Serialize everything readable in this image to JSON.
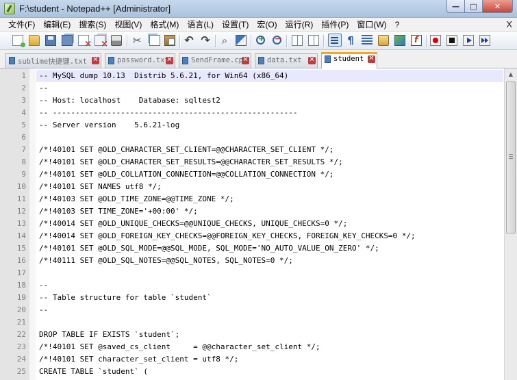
{
  "window": {
    "title": "F:\\student - Notepad++ [Administrator]",
    "min_label": "—",
    "max_label": "□",
    "close_label": "✕"
  },
  "menu": [
    "文件(F)",
    "编辑(E)",
    "搜索(S)",
    "视图(V)",
    "格式(M)",
    "语言(L)",
    "设置(T)",
    "宏(O)",
    "运行(R)",
    "插件(P)",
    "窗口(W)",
    "?"
  ],
  "menubar_close": "X",
  "tabs": [
    {
      "label": "sublime快捷键.txt",
      "active": false
    },
    {
      "label": "password.txt",
      "active": false
    },
    {
      "label": "SendFrame.cpp",
      "active": false
    },
    {
      "label": "data.txt",
      "active": false
    },
    {
      "label": "student",
      "active": true
    }
  ],
  "tab_close_glyph": "✕",
  "editor": {
    "current_line": 1,
    "lines": [
      {
        "n": "1",
        "text": "-- MySQL dump 10.13  Distrib 5.6.21, for Win64 (x86_64)"
      },
      {
        "n": "2",
        "text": "--"
      },
      {
        "n": "3",
        "text": "-- Host: localhost    Database: sqltest2"
      },
      {
        "n": "4",
        "text": "-- ------------------------------------------------------"
      },
      {
        "n": "5",
        "text": "-- Server version\t5.6.21-log"
      },
      {
        "n": "6",
        "text": ""
      },
      {
        "n": "7",
        "text": "/*!40101 SET @OLD_CHARACTER_SET_CLIENT=@@CHARACTER_SET_CLIENT */;"
      },
      {
        "n": "8",
        "text": "/*!40101 SET @OLD_CHARACTER_SET_RESULTS=@@CHARACTER_SET_RESULTS */;"
      },
      {
        "n": "9",
        "text": "/*!40101 SET @OLD_COLLATION_CONNECTION=@@COLLATION_CONNECTION */;"
      },
      {
        "n": "10",
        "text": "/*!40101 SET NAMES utf8 */;"
      },
      {
        "n": "11",
        "text": "/*!40103 SET @OLD_TIME_ZONE=@@TIME_ZONE */;"
      },
      {
        "n": "12",
        "text": "/*!40103 SET TIME_ZONE='+00:00' */;"
      },
      {
        "n": "13",
        "text": "/*!40014 SET @OLD_UNIQUE_CHECKS=@@UNIQUE_CHECKS, UNIQUE_CHECKS=0 */;"
      },
      {
        "n": "14",
        "text": "/*!40014 SET @OLD_FOREIGN_KEY_CHECKS=@@FOREIGN_KEY_CHECKS, FOREIGN_KEY_CHECKS=0 */;"
      },
      {
        "n": "15",
        "text": "/*!40101 SET @OLD_SQL_MODE=@@SQL_MODE, SQL_MODE='NO_AUTO_VALUE_ON_ZERO' */;"
      },
      {
        "n": "16",
        "text": "/*!40111 SET @OLD_SQL_NOTES=@@SQL_NOTES, SQL_NOTES=0 */;"
      },
      {
        "n": "17",
        "text": ""
      },
      {
        "n": "18",
        "text": "--"
      },
      {
        "n": "19",
        "text": "-- Table structure for table `student`"
      },
      {
        "n": "20",
        "text": "--"
      },
      {
        "n": "21",
        "text": ""
      },
      {
        "n": "22",
        "text": "DROP TABLE IF EXISTS `student`;"
      },
      {
        "n": "23",
        "text": "/*!40101 SET @saved_cs_client     = @@character_set_client */;"
      },
      {
        "n": "24",
        "text": "/*!40101 SET character_set_client = utf8 */;"
      },
      {
        "n": "25",
        "text": "CREATE TABLE `student` ("
      }
    ]
  },
  "colors": {
    "current_line": "#e8e8ff",
    "active_tab_accent": "#f5a623",
    "gutter": "#e4e4e4"
  }
}
